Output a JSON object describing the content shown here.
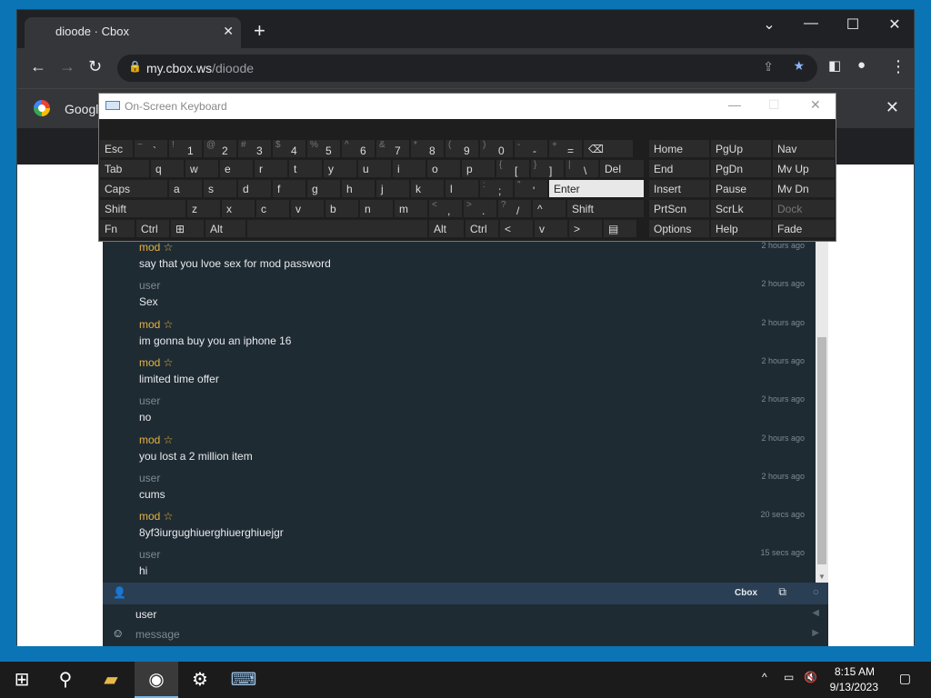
{
  "browser": {
    "tab_title": "dioode · Cbox",
    "url_host": "my.cbox.ws",
    "url_path": "/dioode",
    "bookmark_bar_label": "Google"
  },
  "osk": {
    "title": "On-Screen Keyboard",
    "rows": [
      [
        [
          "Esc",
          ""
        ],
        [
          "`",
          "~"
        ],
        [
          "1",
          "!"
        ],
        [
          "2",
          "@"
        ],
        [
          "3",
          "#"
        ],
        [
          "4",
          "$"
        ],
        [
          "5",
          "%"
        ],
        [
          "6",
          "^"
        ],
        [
          "7",
          "&"
        ],
        [
          "8",
          "*"
        ],
        [
          "9",
          "("
        ],
        [
          "0",
          ")"
        ],
        [
          "-",
          "-"
        ],
        [
          "=",
          "+"
        ],
        [
          "⌫",
          ""
        ]
      ],
      [
        [
          "Tab",
          ""
        ],
        [
          "q",
          ""
        ],
        [
          "w",
          ""
        ],
        [
          "e",
          ""
        ],
        [
          "r",
          ""
        ],
        [
          "t",
          ""
        ],
        [
          "y",
          ""
        ],
        [
          "u",
          ""
        ],
        [
          "i",
          ""
        ],
        [
          "o",
          ""
        ],
        [
          "p",
          ""
        ],
        [
          "[",
          "{"
        ],
        [
          "]",
          "}"
        ],
        [
          "\\",
          "|"
        ],
        [
          "Del",
          ""
        ]
      ],
      [
        [
          "Caps",
          ""
        ],
        [
          "a",
          ""
        ],
        [
          "s",
          ""
        ],
        [
          "d",
          ""
        ],
        [
          "f",
          ""
        ],
        [
          "g",
          ""
        ],
        [
          "h",
          ""
        ],
        [
          "j",
          ""
        ],
        [
          "k",
          ""
        ],
        [
          "l",
          ""
        ],
        [
          ";",
          ":"
        ],
        [
          "'",
          "\""
        ],
        [
          "Enter",
          ""
        ]
      ],
      [
        [
          "Shift",
          ""
        ],
        [
          "z",
          ""
        ],
        [
          "x",
          ""
        ],
        [
          "c",
          ""
        ],
        [
          "v",
          ""
        ],
        [
          "b",
          ""
        ],
        [
          "n",
          ""
        ],
        [
          "m",
          ""
        ],
        [
          ",",
          "<"
        ],
        [
          ".",
          ">"
        ],
        [
          "/",
          "?"
        ],
        [
          "^",
          ""
        ],
        [
          "Shift",
          ""
        ]
      ],
      [
        [
          "Fn",
          ""
        ],
        [
          "Ctrl",
          ""
        ],
        [
          "⊞",
          ""
        ],
        [
          "Alt",
          ""
        ],
        [
          "",
          ""
        ],
        [
          "Alt",
          ""
        ],
        [
          "Ctrl",
          ""
        ],
        [
          "<",
          ""
        ],
        [
          "v",
          ""
        ],
        [
          ">",
          ""
        ],
        [
          "▤",
          ""
        ]
      ]
    ],
    "side": [
      [
        "Home",
        "PgUp",
        "Nav"
      ],
      [
        "End",
        "PgDn",
        "Mv Up"
      ],
      [
        "Insert",
        "Pause",
        "Mv Dn"
      ],
      [
        "PrtScn",
        "ScrLk",
        "Dock"
      ],
      [
        "Options",
        "Help",
        "Fade"
      ]
    ]
  },
  "chat": {
    "messages": [
      {
        "name": "mod ☆",
        "role": "mod",
        "text": "say that you lvoe sex for mod password",
        "time": "2 hours ago"
      },
      {
        "name": "user",
        "role": "user",
        "text": "Sex",
        "time": "2 hours ago"
      },
      {
        "name": "mod ☆",
        "role": "mod",
        "text": "im gonna buy you an iphone 16",
        "time": "2 hours ago"
      },
      {
        "name": "mod ☆",
        "role": "mod",
        "text": "limited time offer",
        "time": "2 hours ago"
      },
      {
        "name": "user",
        "role": "user",
        "text": "no",
        "time": "2 hours ago"
      },
      {
        "name": "mod ☆",
        "role": "mod",
        "text": "you lost a 2 million item",
        "time": "2 hours ago"
      },
      {
        "name": "user",
        "role": "user",
        "text": "cums",
        "time": "2 hours ago"
      },
      {
        "name": "mod ☆",
        "role": "mod",
        "text": "8yf3iurgughiuerghiuerghiuejgr",
        "time": "20 secs ago"
      },
      {
        "name": "user",
        "role": "user",
        "text": "hi",
        "time": "15 secs ago"
      }
    ],
    "brand": "Cbox",
    "name_value": "user",
    "message_placeholder": "message"
  },
  "taskbar": {
    "time": "8:15 AM",
    "date": "9/13/2023"
  }
}
